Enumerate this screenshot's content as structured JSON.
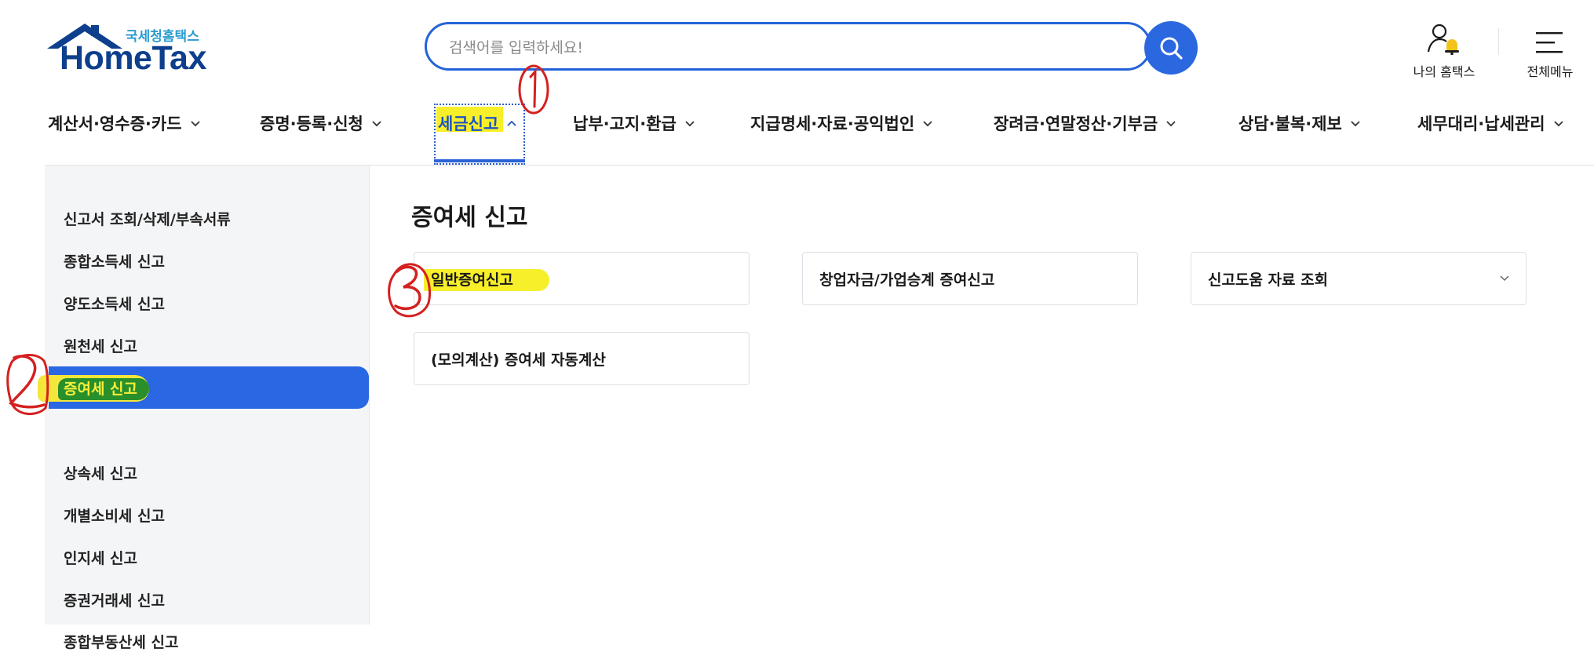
{
  "logo": {
    "sub": "국세청홈택스",
    "main": "HomeTax"
  },
  "search": {
    "placeholder": "검색어를 입력하세요!"
  },
  "utility": {
    "my_hometax": "나의 홈택스",
    "all_menu": "전체메뉴"
  },
  "gnb": [
    {
      "label": "계산서·영수증·카드"
    },
    {
      "label": "증명·등록·신청"
    },
    {
      "label": "세금신고"
    },
    {
      "label": "납부·고지·환급"
    },
    {
      "label": "지급명세·자료·공익법인"
    },
    {
      "label": "장려금·연말정산·기부금"
    },
    {
      "label": "상담·불복·제보"
    },
    {
      "label": "세무대리·납세관리"
    }
  ],
  "side_menu": [
    {
      "label": "신고서 조회/삭제/부속서류"
    },
    {
      "label": "종합소득세 신고"
    },
    {
      "label": "양도소득세 신고"
    },
    {
      "label": "원천세 신고"
    },
    {
      "label": "증여세 신고"
    },
    {
      "label": "상속세 신고"
    },
    {
      "label": "개별소비세 신고"
    },
    {
      "label": "인지세 신고"
    },
    {
      "label": "증권거래세 신고"
    },
    {
      "label": "종합부동산세 신고"
    }
  ],
  "content": {
    "title": "증여세 신고",
    "cards": [
      {
        "label": "일반증여신고"
      },
      {
        "label": "창업자금/가업승계 증여신고"
      },
      {
        "label": "신고도움 자료 조회"
      },
      {
        "label": "(모의계산) 증여세 자동계산"
      }
    ]
  },
  "annotations": {
    "step1": "1",
    "step2": "2",
    "step3": "3"
  },
  "colors": {
    "brand_blue": "#2b68e0",
    "highlight_yellow": "#f7ef2a",
    "annotation_red": "#d42020",
    "marker_green": "#1e8a2a"
  }
}
